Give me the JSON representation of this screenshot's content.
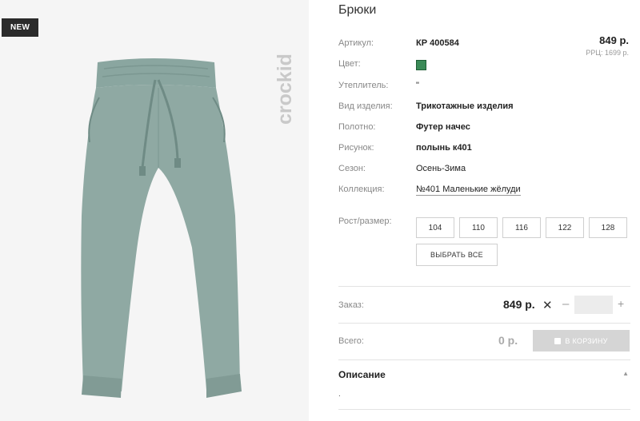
{
  "badge": "NEW",
  "brand": "crockid",
  "product": {
    "title": "Брюки",
    "price": "849 р.",
    "rrp": "РРЦ: 1699 р."
  },
  "specs": [
    {
      "label": "Артикул:",
      "value": "КР 400584"
    },
    {
      "label": "Цвет:",
      "value": ""
    },
    {
      "label": "Утеплитель:",
      "value": "\""
    },
    {
      "label": "Вид изделия:",
      "value": "Трикотажные изделия"
    },
    {
      "label": "Полотно:",
      "value": "Футер начес"
    },
    {
      "label": "Рисунок:",
      "value": "полынь к401"
    },
    {
      "label": "Сезон:",
      "value": "Осень-Зима"
    },
    {
      "label": "Коллекция:",
      "value": "№401 Маленькие жёлуди"
    }
  ],
  "color_swatch": "#3a8a57",
  "sizes_label": "Рост/размер:",
  "sizes": [
    "104",
    "110",
    "116",
    "122",
    "128"
  ],
  "select_all": "ВЫБРАТЬ ВСЕ",
  "order": {
    "label": "Заказ:",
    "price": "849 р.",
    "times": "✕",
    "minus": "–",
    "plus": "+",
    "quantity": ""
  },
  "total": {
    "label": "Всего:",
    "value": "0 р.",
    "cart_button": "В КОРЗИНУ"
  },
  "description": {
    "title": "Описание",
    "caret": "▲",
    "text": "."
  }
}
